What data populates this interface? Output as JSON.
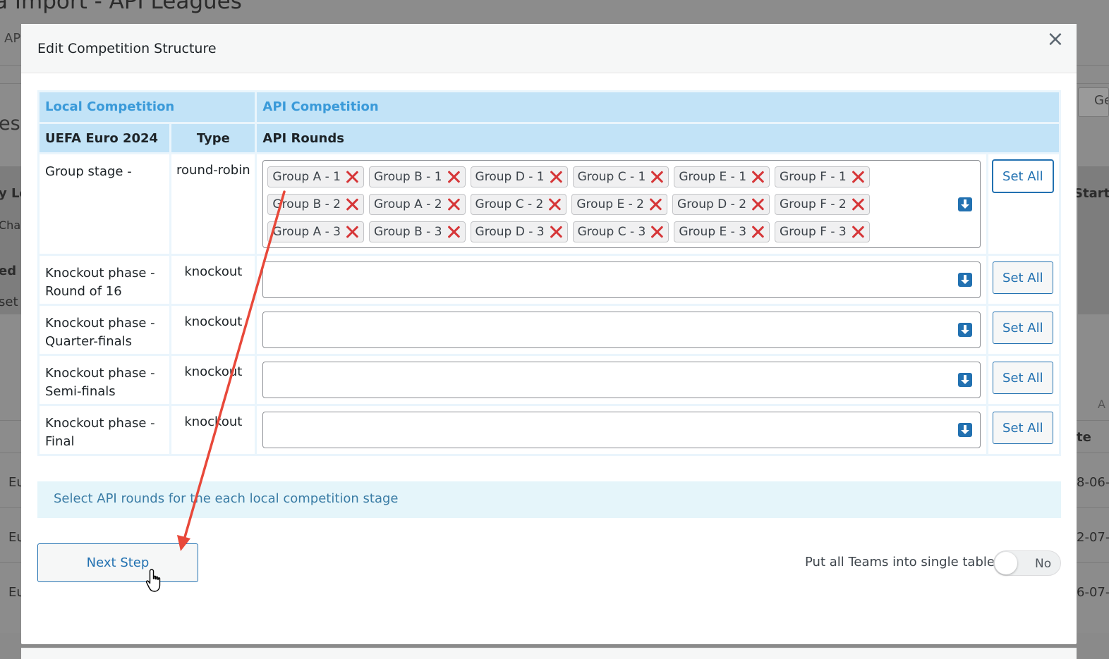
{
  "background": {
    "page_title": "a Import - API Leagues",
    "tab_fragment": "AP",
    "heading_fragment": "es",
    "left_fragments": [
      "y Le",
      "Char",
      "ed",
      "set",
      "Eu",
      "Eu",
      "Eu"
    ],
    "right_fragments": [
      "Ge",
      "Start",
      "A",
      "te",
      "8-06-",
      "2-07-",
      "6-07-"
    ]
  },
  "modal": {
    "title": "Edit Competition Structure",
    "close_label": "×",
    "table": {
      "header_local": "Local Competition",
      "header_api": "API Competition",
      "col_competition": "UEFA Euro 2024",
      "col_type": "Type",
      "col_api_rounds": "API Rounds",
      "rows": [
        {
          "stage": "Group stage -",
          "type": "round-robin",
          "chips": [
            "Group A - 1",
            "Group B - 1",
            "Group D - 1",
            "Group C - 1",
            "Group E - 1",
            "Group F - 1",
            "Group B - 2",
            "Group A - 2",
            "Group C - 2",
            "Group E - 2",
            "Group D - 2",
            "Group F - 2",
            "Group A - 3",
            "Group B - 3",
            "Group D - 3",
            "Group C - 3",
            "Group E - 3",
            "Group F - 3"
          ],
          "set_all": "Set All"
        },
        {
          "stage": "Knockout phase - Round of 16",
          "type": "knockout",
          "chips": [],
          "set_all": "Set All"
        },
        {
          "stage": "Knockout phase - Quarter-finals",
          "type": "knockout",
          "chips": [],
          "set_all": "Set All"
        },
        {
          "stage": "Knockout phase - Semi-finals",
          "type": "knockout",
          "chips": [],
          "set_all": "Set All"
        },
        {
          "stage": "Knockout phase - Final",
          "type": "knockout",
          "chips": [],
          "set_all": "Set All"
        }
      ]
    },
    "notice": "Select API rounds for the each local competition stage",
    "next_step": "Next Step",
    "toggle": {
      "label": "Put all Teams into single table",
      "state": "No"
    }
  },
  "colors": {
    "accent": "#2271b1",
    "header_bg": "#c2e3f7",
    "remove": "#d63638",
    "arrow": "#e8483a"
  }
}
